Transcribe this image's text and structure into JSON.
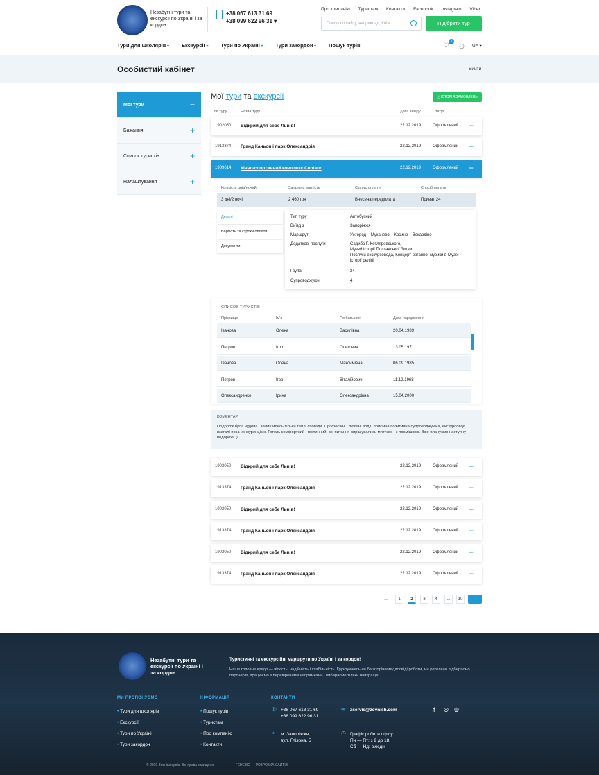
{
  "header": {
    "tagline": "Незабутні тури та екскурсії по Україні і за кордон",
    "phone1": "+38 067 613 31 69",
    "phone2": "+38 099 622 96 31 ▾",
    "topnav": [
      "Про компанію",
      "Туристам",
      "Контакти",
      "Facebook",
      "Instagram",
      "Viber"
    ],
    "search_placeholder": "Пошук по сайту, наприклад, Київ",
    "cta": "Підібрати тур",
    "menu": [
      "Тури для школярів",
      "Екскурсії",
      "Тури по Україні",
      "Тури закордон",
      "Пошук турів"
    ],
    "wish_count": "1",
    "lang": "UA ▾"
  },
  "page": {
    "title": "Особистий кабінет",
    "logout": "Вийти"
  },
  "sidebar": [
    "Мої тури",
    "Бажання",
    "Список туристів",
    "Налаштування"
  ],
  "main": {
    "title_pre": "Мої ",
    "title_link1": "тури",
    "title_mid": " та ",
    "title_link2": "екскурсії",
    "history_btn": "ІСТОРІЯ ЗАМОВЛЕНЬ",
    "cols": [
      "№ туру",
      "Назва туру",
      "Дата виїзду",
      "Статус"
    ]
  },
  "orders_top": [
    {
      "id": "1902050",
      "name": "Відкрий для себе Львів!",
      "date": "22.12.2019",
      "status": "Оформлений"
    },
    {
      "id": "1913374",
      "name": "Гранд Каньон і парк Олександрія",
      "date": "22.12.2019",
      "status": "Оформлений"
    },
    {
      "id": "1909614",
      "name": "Кінно-спортивний комплекс Centaur",
      "date": "22.12.2019",
      "status": "Оформлений"
    }
  ],
  "details": {
    "heads": [
      "Кількість днів/ночей",
      "Загальна вартість",
      "Статус оплати",
      "Спосіб оплати"
    ],
    "vals": [
      "3 дні/2 ночі",
      "2 460 грн",
      "Внесена передплата",
      "Приват 24"
    ],
    "tabs": [
      "Деталі",
      "Вартість та строки оплати",
      "Документи"
    ],
    "info": [
      [
        "Тип туру",
        "Автобусний"
      ],
      [
        "Виїзд з",
        "Запоріжжя"
      ],
      [
        "Маршрут",
        "Ужгород – Мукачево – Косино – Вскаодіно"
      ],
      [
        "Додаткові послуги",
        "Садиба Г. Котляревського,"
      ],
      [
        "",
        "Музей історії Полтавської битви"
      ],
      [
        "",
        "Послуги екскурсовода, Концерт органної музики в Музеї"
      ],
      [
        "",
        "історії релігії"
      ],
      [
        "Група",
        "24"
      ],
      [
        "Супроводжуючі",
        "4"
      ]
    ]
  },
  "tourists": {
    "caption": "СПИСОК ТУРИСТІВ",
    "cols": [
      "Прізвище",
      "Ім'я",
      "По батькові",
      "Дата народження"
    ],
    "rows": [
      [
        "Іванова",
        "Олена",
        "Василівна",
        "20.04.1989"
      ],
      [
        "Петров",
        "Ігор",
        "Олегович",
        "13.05.1971"
      ],
      [
        "Іванова",
        "Олена",
        "Максимівна",
        "06.09.1985"
      ],
      [
        "Петров",
        "Ігор",
        "Віталійович",
        "11.12.1968"
      ],
      [
        "Олександренко",
        "Ірина",
        "Олександрівна",
        "15.04.2000"
      ]
    ]
  },
  "comment": {
    "caption": "КОМЕНТАР",
    "text": "Подорож була чудова і залишились тільки теплі спогади. Професійні і людяні водії, приємна позитивна супроводжуюча, екскурсовод взагалі поза конкуренцією. Готель комфортний і гостинний, всі питання вирішувались миттєво і з посмішкою. Вже плануємо наступну подорож! :)"
  },
  "orders_bottom": [
    {
      "id": "1902050",
      "name": "Відкрий для себе Львів!",
      "date": "22.12.2019",
      "status": "Оформлений"
    },
    {
      "id": "1913374",
      "name": "Гранд Каньон і парк Олександрія",
      "date": "22.12.2019",
      "status": "Оформлений"
    },
    {
      "id": "1902050",
      "name": "Відкрий для себе Львів!",
      "date": "22.12.2019",
      "status": "Оформлений"
    },
    {
      "id": "1913374",
      "name": "Гранд Каньон і парк Олександрія",
      "date": "22.12.2019",
      "status": "Оформлений"
    },
    {
      "id": "1902050",
      "name": "Відкрий для себе Львів!",
      "date": "22.12.2019",
      "status": "Оформлений"
    },
    {
      "id": "1913374",
      "name": "Гранд Каньон і парк Олександрія",
      "date": "22.12.2019",
      "status": "Оформлений"
    }
  ],
  "pagination": {
    "prev": "←",
    "pages": [
      "1",
      "2",
      "3",
      "4",
      "...",
      "10"
    ],
    "current": "2",
    "next": "→"
  },
  "footer": {
    "tagline": "Незабутні тури та екскурсії по Україні і за кордон",
    "head": "Туристичні та екскурсійні маршрути по Україні і за кордон!",
    "desc": "Наше головне кредо — чіткість, надійність і стабільність. Грунтуючись на багаторічному досвіді роботи, ми ретельно підбираємо партнерів, працюємо з перевіреними напрямками і вибираємо тільки найкраще.",
    "cap1": "МИ ПРОПОНУЄМО",
    "list1": [
      "Тури для школярів",
      "Екскурсії",
      "Тури по Україні",
      "Тури закордон"
    ],
    "cap2": "ІНФОРМАЦІЯ",
    "list2": [
      "Пошук турів",
      "Туристам",
      "Про компанію",
      "Контакти"
    ],
    "cap3": "КОНТАКТИ",
    "phone1": "+38 067 613 31 69",
    "phone2": "+38 099 622 96 31",
    "email": "zservis@zovnish.com",
    "addr1": "м. Запоріжжя,",
    "addr2": "вул. Гліэрна, 5",
    "hours_title": "Графік роботи офісу:",
    "hours1": "Пн — Пт: з 9 до 18,",
    "hours2": "Сб — Нд: вихідні",
    "copy": "© 2019 Зовнішсервіс. Всі права захищено",
    "dev": "ГЕНЕЗІС — РОЗРОБКА САЙТІВ"
  },
  "colors": {
    "accent": "#1e9bd7",
    "green": "#27c566"
  }
}
